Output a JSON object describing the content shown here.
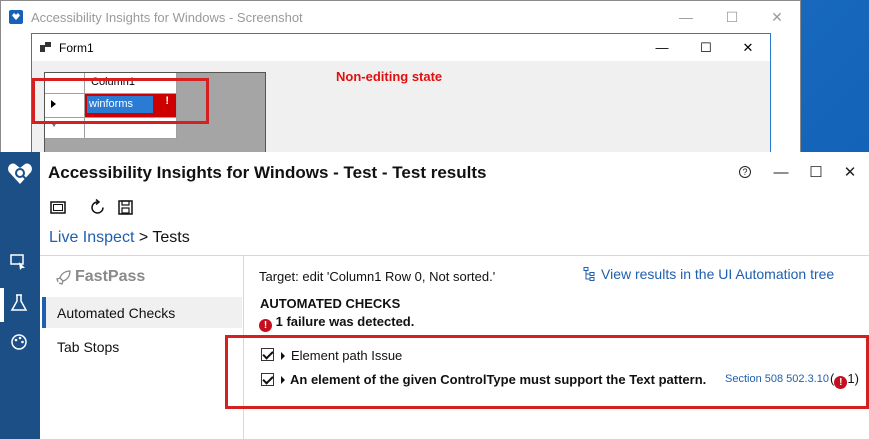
{
  "screenshot_window": {
    "title": "Accessibility Insights for Windows - Screenshot",
    "minimize": "—",
    "maximize": "☐",
    "close": "✕"
  },
  "form1": {
    "title": "Form1",
    "minimize": "—",
    "maximize": "☐",
    "close": "✕",
    "grid": {
      "column_header": "Column1",
      "cell_value": "winforms",
      "error_mark": "!",
      "new_row_marker": "*"
    },
    "annotation": "Non-editing state"
  },
  "main_window": {
    "title": "Accessibility Insights for Windows - Test - Test results",
    "help": "?",
    "minimize": "—",
    "maximize": "☐",
    "close": "✕",
    "breadcrumb": {
      "link": "Live Inspect",
      "separator": ">",
      "current": "Tests"
    },
    "left_nav": {
      "fastpass": "FastPass",
      "items": [
        {
          "label": "Automated Checks",
          "selected": true
        },
        {
          "label": "Tab Stops",
          "selected": false
        }
      ]
    },
    "results": {
      "target": "Target: edit 'Column1 Row 0, Not sorted.'",
      "tree_link": "View results in the UI Automation tree",
      "heading": "AUTOMATED CHECKS",
      "failure_icon": "!",
      "failure_text": "1 failure was detected.",
      "rows": [
        {
          "label": "Element path  Issue",
          "checked": true
        },
        {
          "label": "An element of the given ControlType must support the Text pattern.",
          "section": "Section 508 502.3.10",
          "count_open": "(",
          "count_icon": "!",
          "count_close": "1)",
          "checked": true
        }
      ]
    }
  },
  "colors": {
    "accent": "#1f5fb0",
    "rail": "#1b4f86",
    "highlight_box": "#d42020",
    "error": "#c50f1f"
  }
}
